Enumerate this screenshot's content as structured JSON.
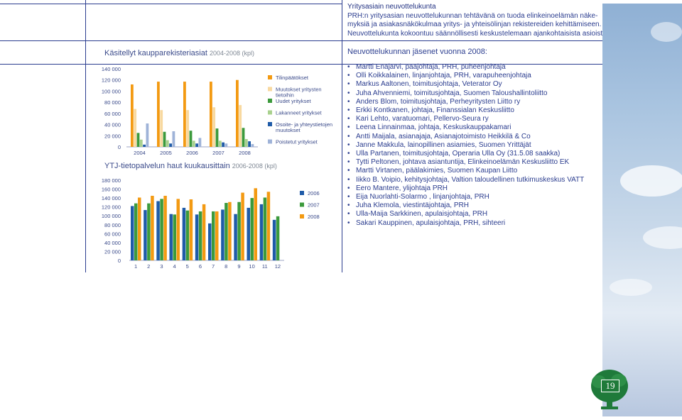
{
  "intro": {
    "heading": "Yritysasiain neuvottelukunta",
    "lines": [
      "PRH:n yritysasian neuvottelukunnan tehtävänä on tuoda elinkeinoelämän näke-",
      "myksiä ja asiakasnäkökulmaa yritys- ja yhteisölinjan rekistereiden kehittämiseen.",
      "Neuvottelukunta kokoontuu säännöllisesti keskustelemaan ajankohtaisista asioista."
    ]
  },
  "members": {
    "heading": "Neuvottelukunnan jäsenet vuonna 2008:",
    "items": [
      "Martti Enäjärvi, pääjohtaja, PRH, puheenjohtaja",
      "Olli Koikkalainen, linjanjohtaja, PRH, varapuheenjohtaja",
      "Markus Aaltonen, toimitusjohtaja, Veterator Oy",
      "Juha Ahvenniemi, toimitusjohtaja, Suomen Taloushallintoliitto",
      "Anders Blom, toimitusjohtaja, Perheyritysten Liitto ry",
      "Erkki Kontkanen, johtaja, Finanssialan Keskusliitto",
      "Kari Lehto, varatuomari, Pellervo-Seura ry",
      "Leena Linnainmaa, johtaja, Keskuskauppakamari",
      "Antti Maijala, asianajaja, Asianajotoimisto Heikkilä & Co",
      "Janne Makkula, lainopillinen asiamies, Suomen Yrittäjät",
      "Ulla Partanen, toimitusjohtaja, Operaria Ulla Oy (31.5.08 saakka)",
      "Tytti Peltonen, johtava asiantuntija, Elinkeinoelämän Keskusliitto EK",
      "Martti Virtanen, päälakimies, Suomen Kaupan Liitto",
      "Iikko B. Voipio, kehitysjohtaja, Valtion taloudellinen tutkimuskeskus VATT",
      "Eero Mantere, ylijohtaja PRH",
      "Eija Nuorlahti-Solarmo , linjanjohtaja, PRH",
      "Juha Klemola, viestintäjohtaja, PRH",
      "Ulla-Maija Sarkkinen, apulaisjohtaja, PRH",
      "Sakari Kauppinen, apulaisjohtaja, PRH, sihteeri"
    ]
  },
  "page_number": "19",
  "chart_data": [
    {
      "type": "bar",
      "title": "Käsitellyt kaupparekisteriasiat",
      "subtitle": "2004-2008 (kpl)",
      "categories": [
        "2004",
        "2005",
        "2006",
        "2007",
        "2008"
      ],
      "ylim": [
        0,
        140000
      ],
      "yticks": [
        "140 000",
        "120 000",
        "100 000",
        "80 000",
        "60 000",
        "40 000",
        "20 000",
        "0"
      ],
      "legend_position": "right",
      "series": [
        {
          "name": "Tilinpäätökset",
          "color": "#f39a12",
          "values": [
            112000,
            117000,
            117000,
            117000,
            120000
          ]
        },
        {
          "name": "Muutokset yritysten tietoihin",
          "color": "#f8d9a0",
          "values": [
            68000,
            66000,
            66000,
            71000,
            75000
          ]
        },
        {
          "name": "Uudet yritykset",
          "color": "#3c9a3c",
          "values": [
            25000,
            27000,
            29000,
            33000,
            34000
          ]
        },
        {
          "name": "Lakanneet yritykset",
          "color": "#a9d18e",
          "values": [
            13000,
            12000,
            11000,
            11000,
            14000
          ]
        },
        {
          "name": "Osoite- ja yhteystietojen muutokset",
          "color": "#1f5ba8",
          "values": [
            4000,
            6000,
            6000,
            8000,
            10000
          ]
        },
        {
          "name": "Poistetut yritykset",
          "color": "#9fb3d8",
          "values": [
            42000,
            28000,
            16000,
            6000,
            5000
          ]
        }
      ]
    },
    {
      "type": "bar",
      "title": "YTJ-tietopalvelun haut kuukausittain",
      "subtitle": "2006-2008 (kpl)",
      "categories": [
        "1",
        "2",
        "3",
        "4",
        "5",
        "6",
        "7",
        "8",
        "9",
        "10",
        "11",
        "12"
      ],
      "ylim": [
        0,
        180000
      ],
      "yticks": [
        "180 000",
        "160 000",
        "140 000",
        "120 000",
        "100 000",
        "80 000",
        "60 000",
        "40 000",
        "20 000",
        "0"
      ],
      "legend_position": "right",
      "series": [
        {
          "name": "2006",
          "color": "#1f5ba8",
          "values": [
            122000,
            113000,
            133000,
            104000,
            118000,
            103000,
            83000,
            114000,
            104000,
            118000,
            126000,
            91000
          ]
        },
        {
          "name": "2007",
          "color": "#3c9a3c",
          "values": [
            128000,
            128000,
            138000,
            103000,
            112000,
            110000,
            110000,
            129000,
            131000,
            140000,
            141000,
            99000
          ]
        },
        {
          "name": "2008",
          "color": "#f39a12",
          "values": [
            141000,
            145000,
            145000,
            138000,
            137000,
            126000,
            110000,
            131000,
            152000,
            162000,
            154000,
            0
          ]
        }
      ]
    }
  ]
}
